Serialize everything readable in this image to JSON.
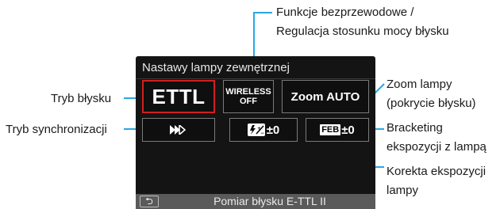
{
  "screen": {
    "title": "Nastawy lampy zewnętrznej",
    "ettl_label": "ETTL",
    "wireless_line1": "WIRELESS",
    "wireless_line2": "OFF",
    "zoom_label": "Zoom AUTO",
    "fec_value": "±0",
    "feb_badge": "FEB",
    "feb_value": "±0",
    "footer_text": "Pomiar błysku E-TTL II",
    "selected_color": "#d21f1f"
  },
  "callouts": {
    "wireless_line1": "Funkcje bezprzewodowe /",
    "wireless_line2": "Regulacja stosunku mocy błysku",
    "flash_mode": "Tryb błysku",
    "sync_mode": "Tryb synchronizacji",
    "zoom_line1": "Zoom lampy",
    "zoom_line2": "(pokrycie błysku)",
    "feb_line1": "Bracketing",
    "feb_line2": "ekspozycji z lampą",
    "fec_line1": "Korekta ekspozycji",
    "fec_line2": "lampy"
  },
  "colors": {
    "callout_line": "#29a8e0"
  }
}
